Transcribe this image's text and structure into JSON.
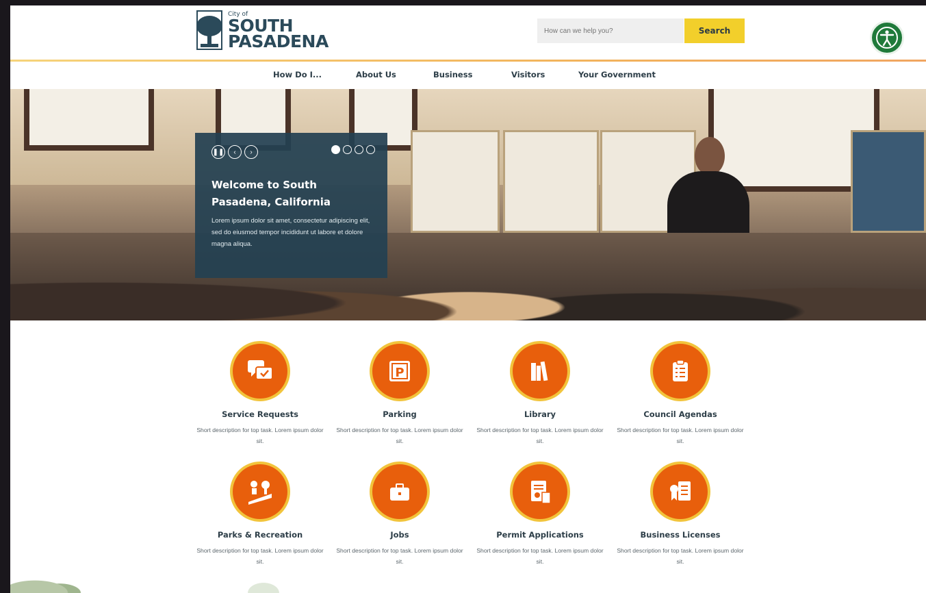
{
  "header": {
    "logo": {
      "city": "City of",
      "name_line1": "SOUTH",
      "name_line2": "PASADENA"
    },
    "search": {
      "placeholder": "How can we help you?",
      "button": "Search"
    },
    "accessibility_icon": "accessibility-icon"
  },
  "nav": {
    "items": [
      "How Do I...",
      "About Us",
      "Business",
      "Visitors",
      "Your Government"
    ]
  },
  "hero": {
    "title": "Welcome to South Pasadena, California",
    "body": "Lorem ipsum dolor sit amet, consectetur adipiscing elit, sed do eiusmod tempor incididunt ut labore et dolore magna aliqua.",
    "slide_count": 4,
    "active_slide": 1
  },
  "tasks": [
    {
      "title": "Service Requests",
      "desc": "Short description for top task. Lorem ipsum dolor sit.",
      "icon": "chat-bubbles-icon"
    },
    {
      "title": "Parking",
      "desc": "Short description for top task. Lorem ipsum dolor sit.",
      "icon": "parking-icon"
    },
    {
      "title": "Library",
      "desc": "Short description for top task. Lorem ipsum dolor sit.",
      "icon": "books-icon"
    },
    {
      "title": "Council Agendas",
      "desc": "Short description for top task. Lorem ipsum dolor sit.",
      "icon": "clipboard-icon"
    },
    {
      "title": "Parks & Recreation",
      "desc": "Short description for top task. Lorem ipsum dolor sit.",
      "icon": "park-icon"
    },
    {
      "title": "Jobs",
      "desc": "Short description for top task. Lorem ipsum dolor sit.",
      "icon": "briefcase-icon"
    },
    {
      "title": "Permit Applications",
      "desc": "Short description for top task. Lorem ipsum dolor sit.",
      "icon": "permit-icon"
    },
    {
      "title": "Business Licenses",
      "desc": "Short description for top task. Lorem ipsum dolor sit.",
      "icon": "license-icon"
    }
  ],
  "colors": {
    "brand_navy": "#2b4a5a",
    "accent_orange": "#e85f0c",
    "accent_yellow": "#f2cf2b",
    "accessibility_green": "#1f7a3a"
  }
}
